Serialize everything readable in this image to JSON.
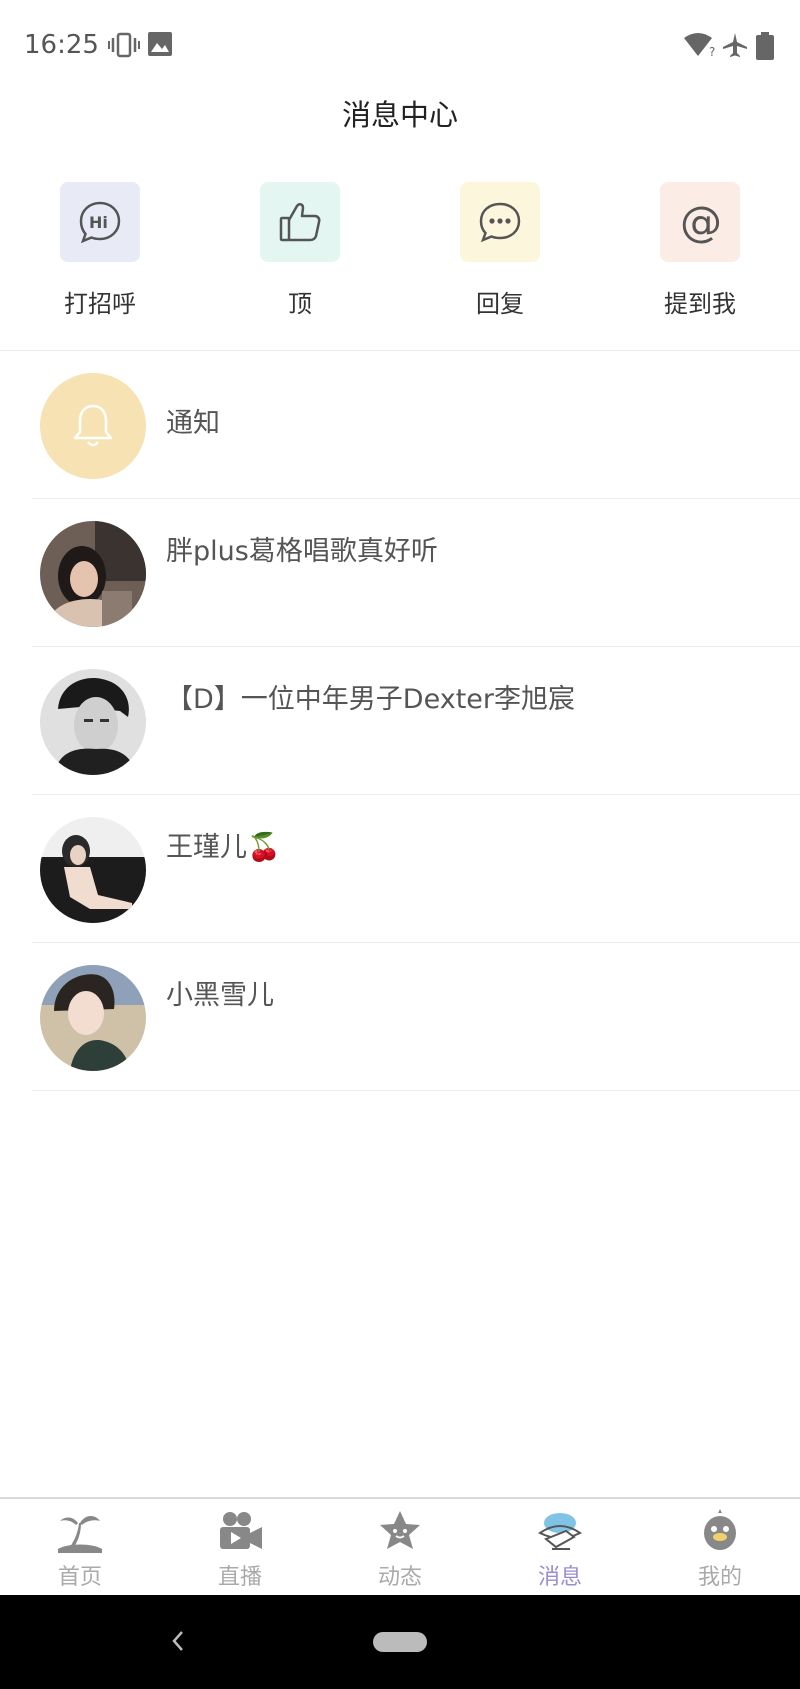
{
  "status_bar": {
    "time": "16:25"
  },
  "header": {
    "title": "消息中心"
  },
  "quick_actions": [
    {
      "label": "打招呼",
      "icon": "hi-bubble-icon",
      "tile_color": "#e8eaf5"
    },
    {
      "label": "顶",
      "icon": "thumbs-up-icon",
      "tile_color": "#e3f6f1"
    },
    {
      "label": "回复",
      "icon": "chat-bubble-icon",
      "tile_color": "#fbf6dc"
    },
    {
      "label": "提到我",
      "icon": "at-icon",
      "tile_color": "#fbece6"
    }
  ],
  "messages": [
    {
      "name": "通知",
      "avatar": "bell-icon"
    },
    {
      "name": "胖plus葛格唱歌真好听",
      "avatar": "user-avatar"
    },
    {
      "name": "【D】一位中年男子Dexter李旭宸",
      "avatar": "user-avatar"
    },
    {
      "name": "王瑾儿🍒",
      "avatar": "user-avatar"
    },
    {
      "name": "小黑雪儿",
      "avatar": "user-avatar"
    }
  ],
  "bottom_nav": [
    {
      "label": "首页",
      "icon": "palm-tree-icon",
      "active": false
    },
    {
      "label": "直播",
      "icon": "video-camera-icon",
      "active": false
    },
    {
      "label": "动态",
      "icon": "star-icon",
      "active": false
    },
    {
      "label": "消息",
      "icon": "message-planet-icon",
      "active": true
    },
    {
      "label": "我的",
      "icon": "bird-icon",
      "active": false
    }
  ],
  "colors": {
    "active_tab": "#9a8ecf",
    "inactive_tab": "#aaaaaa",
    "notification_avatar": "#f7e2b3"
  }
}
